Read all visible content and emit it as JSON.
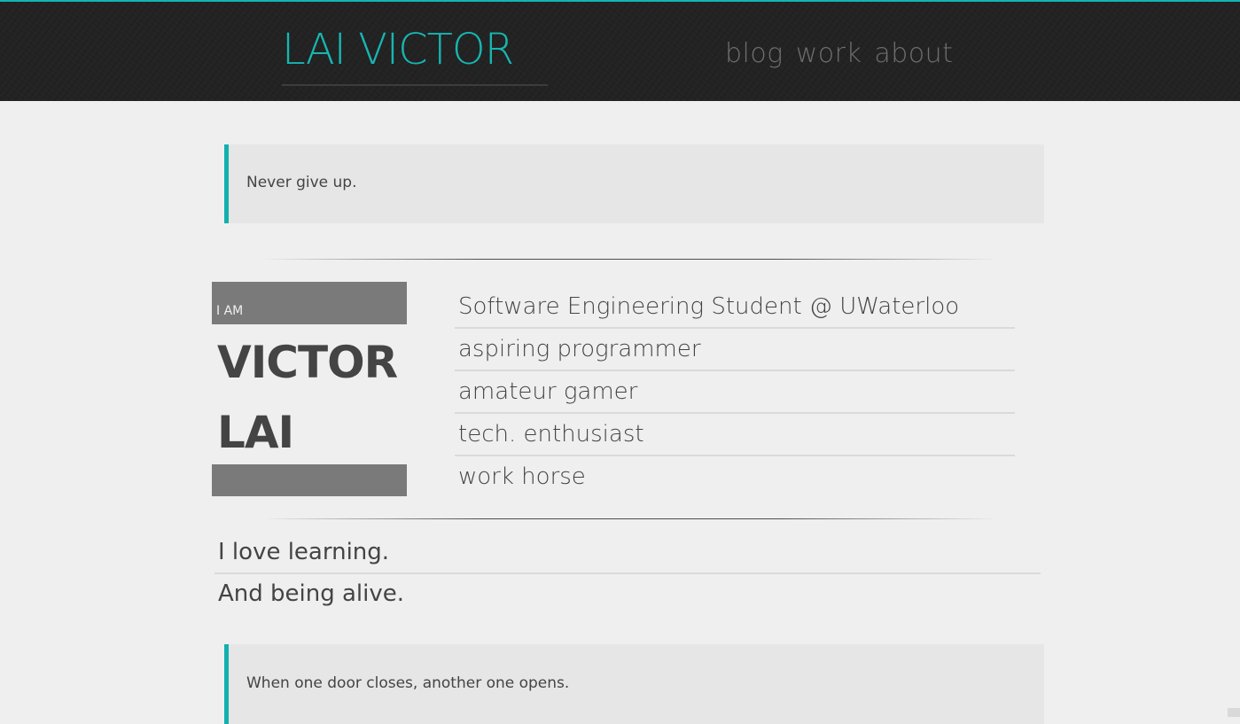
{
  "header": {
    "logo": "LAI VICTOR",
    "nav": [
      {
        "label": "blog"
      },
      {
        "label": "work"
      },
      {
        "label": "about"
      }
    ]
  },
  "quotes": {
    "top": "Never give up.",
    "bottom": "When one door closes, another one opens."
  },
  "profile": {
    "intro_label": "I AM",
    "first_name": "VICTOR",
    "last_name": "LAI",
    "traits": [
      "Software Engineering Student @ UWaterloo",
      "aspiring programmer",
      "amateur gamer",
      "tech. enthusiast",
      "work horse"
    ]
  },
  "statements": [
    "I love learning.",
    "And being alive."
  ],
  "colors": {
    "accent": "#12b5b3",
    "header_bg": "#232323",
    "page_bg": "#efefef",
    "name_block_bg": "#7a7a7a"
  }
}
